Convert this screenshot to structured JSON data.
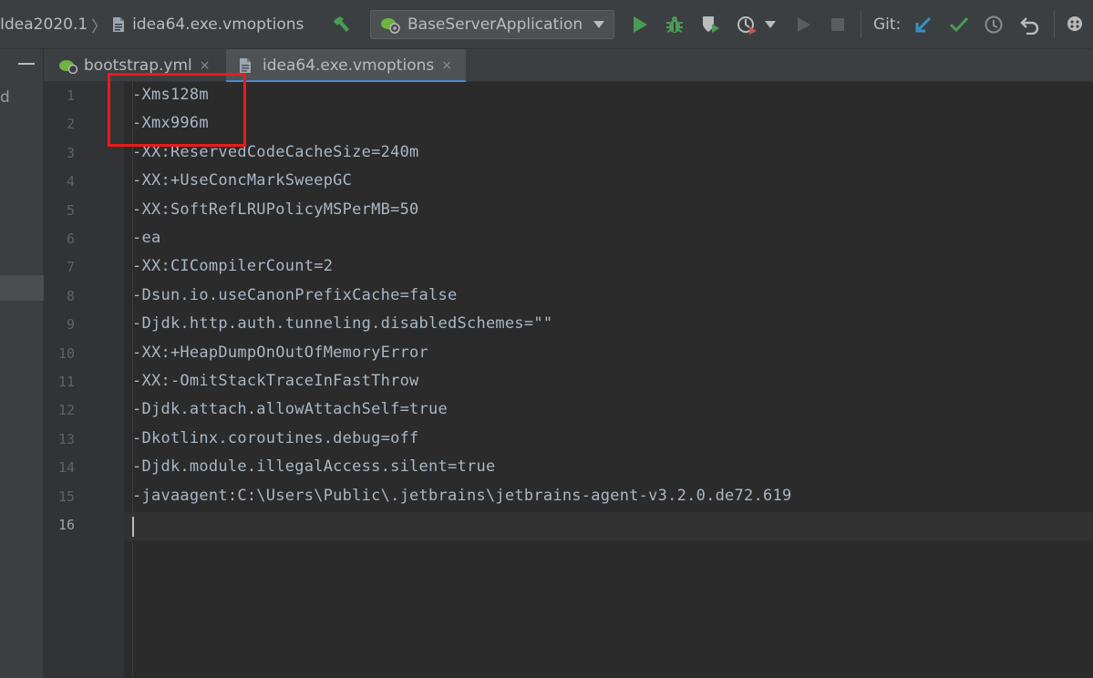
{
  "toolbar": {
    "project_name": "Idea2020.1",
    "breadcrumb_separator": "〉",
    "file_name": "idea64.exe.vmoptions",
    "run_config": "BaseServerApplication",
    "git_label": "Git:"
  },
  "left_panel": {
    "clipped_text": "d"
  },
  "tabs": [
    {
      "label": "bootstrap.yml",
      "close": "×",
      "icon": "spring-leaf-icon",
      "active": false
    },
    {
      "label": "idea64.exe.vmoptions",
      "close": "×",
      "icon": "file-icon",
      "active": true
    }
  ],
  "editor": {
    "line_numbers": [
      "1",
      "2",
      "3",
      "4",
      "5",
      "6",
      "7",
      "8",
      "9",
      "10",
      "11",
      "12",
      "13",
      "14",
      "15",
      "16"
    ],
    "current_line": 16,
    "lines": [
      "-Xms128m",
      "-Xmx996m",
      "-XX:ReservedCodeCacheSize=240m",
      "-XX:+UseConcMarkSweepGC",
      "-XX:SoftRefLRUPolicyMSPerMB=50",
      "-ea",
      "-XX:CICompilerCount=2",
      "-Dsun.io.useCanonPrefixCache=false",
      "-Djdk.http.auth.tunneling.disabledSchemes=\"\"",
      "-XX:+HeapDumpOnOutOfMemoryError",
      "-XX:-OmitStackTraceInFastThrow",
      "-Djdk.attach.allowAttachSelf=true",
      "-Dkotlinx.coroutines.debug=off",
      "-Djdk.module.illegalAccess.silent=true",
      "-javaagent:C:\\Users\\Public\\.jetbrains\\jetbrains-agent-v3.2.0.de72.619",
      ""
    ]
  },
  "colors": {
    "run_green": "#499c54",
    "git_blue": "#3592c4",
    "annotation_red": "#e81c1c",
    "tab_underline": "#4a88c7"
  }
}
